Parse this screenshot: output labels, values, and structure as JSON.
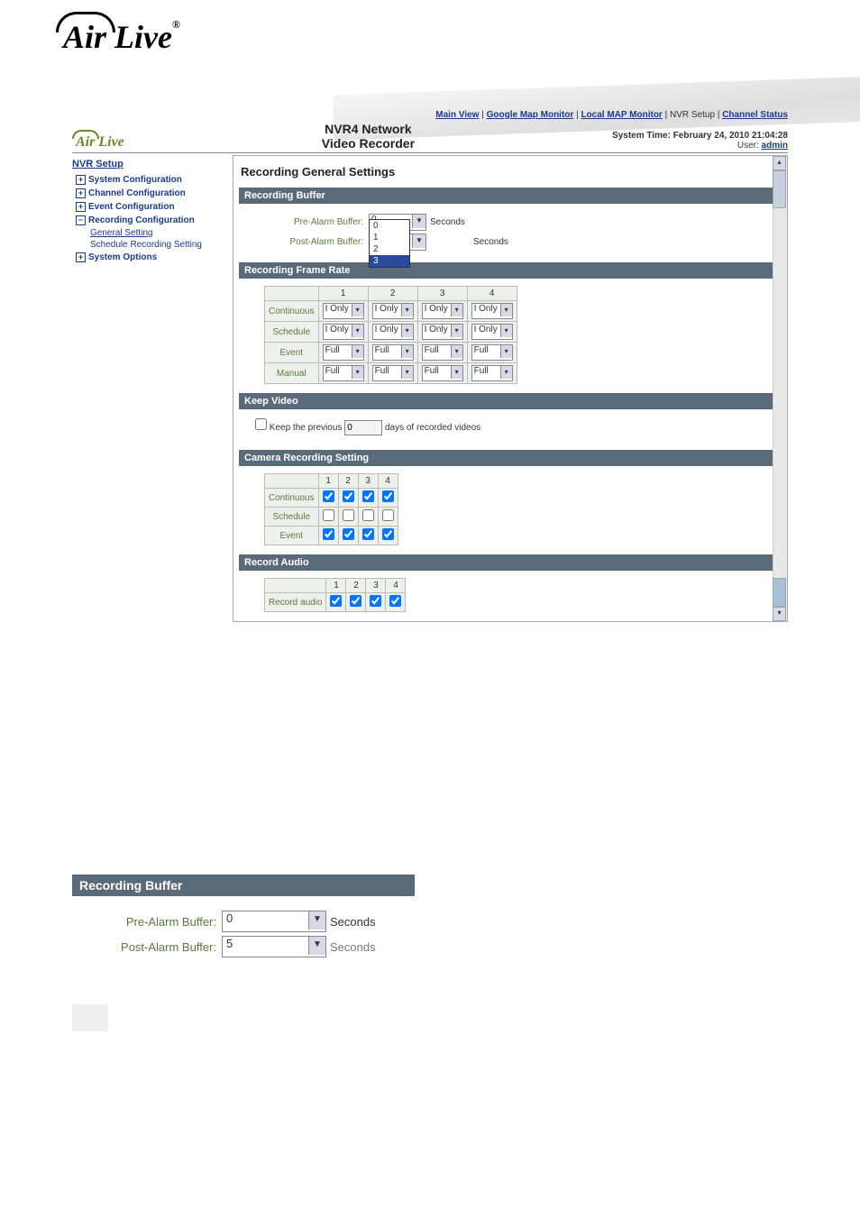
{
  "brand": "Air Live",
  "product_line1": "NVR4 Network",
  "product_line2": "Video Recorder",
  "top_nav": {
    "main_view": "Main View",
    "google_map": "Google Map Monitor",
    "local_map": "Local MAP Monitor",
    "nvr_setup": "NVR Setup",
    "channel_status": "Channel Status"
  },
  "system_time_label": "System Time:",
  "system_time_value": "February 24, 2010 21:04:28",
  "user_label": "User:",
  "user_value": "admin",
  "sidebar": {
    "title": "NVR Setup",
    "items": [
      {
        "label": "System Configuration",
        "expanded": false
      },
      {
        "label": "Channel Configuration",
        "expanded": false
      },
      {
        "label": "Event Configuration",
        "expanded": false
      },
      {
        "label": "Recording Configuration",
        "expanded": true,
        "children": [
          {
            "label": "General Setting",
            "active": true
          },
          {
            "label": "Schedule Recording Setting",
            "active": false
          }
        ]
      },
      {
        "label": "System Options",
        "expanded": false
      }
    ]
  },
  "content": {
    "title": "Recording General Settings",
    "recording_buffer": {
      "header": "Recording Buffer",
      "pre_label": "Pre-Alarm Buffer:",
      "pre_value": "0",
      "pre_options": [
        "0",
        "1",
        "2",
        "3"
      ],
      "post_label": "Post-Alarm Buffer:",
      "post_value": "",
      "unit": "Seconds"
    },
    "frame_rate": {
      "header": "Recording Frame Rate",
      "cols": [
        "1",
        "2",
        "3",
        "4"
      ],
      "rows": [
        {
          "label": "Continuous",
          "vals": [
            "I Only",
            "I Only",
            "I Only",
            "I Only"
          ]
        },
        {
          "label": "Schedule",
          "vals": [
            "I Only",
            "I Only",
            "I Only",
            "I Only"
          ]
        },
        {
          "label": "Event",
          "vals": [
            "Full",
            "Full",
            "Full",
            "Full"
          ]
        },
        {
          "label": "Manual",
          "vals": [
            "Full",
            "Full",
            "Full",
            "Full"
          ]
        }
      ]
    },
    "keep_video": {
      "header": "Keep Video",
      "checked": false,
      "text_before": "Keep the previous",
      "value": "0",
      "text_after": "days of recorded videos"
    },
    "camera_setting": {
      "header": "Camera Recording Setting",
      "cols": [
        "1",
        "2",
        "3",
        "4"
      ],
      "rows": [
        {
          "label": "Continuous",
          "vals": [
            true,
            true,
            true,
            true
          ]
        },
        {
          "label": "Schedule",
          "vals": [
            false,
            false,
            false,
            false
          ]
        },
        {
          "label": "Event",
          "vals": [
            true,
            true,
            true,
            true
          ]
        }
      ]
    },
    "record_audio": {
      "header": "Record Audio",
      "cols": [
        "1",
        "2",
        "3",
        "4"
      ],
      "row": {
        "label": "Record audio",
        "vals": [
          true,
          true,
          true,
          true
        ]
      }
    }
  },
  "detail": {
    "header": "Recording Buffer",
    "pre_label": "Pre-Alarm Buffer:",
    "pre_value": "0",
    "post_label": "Post-Alarm Buffer:",
    "post_value": "5",
    "unit": "Seconds"
  }
}
